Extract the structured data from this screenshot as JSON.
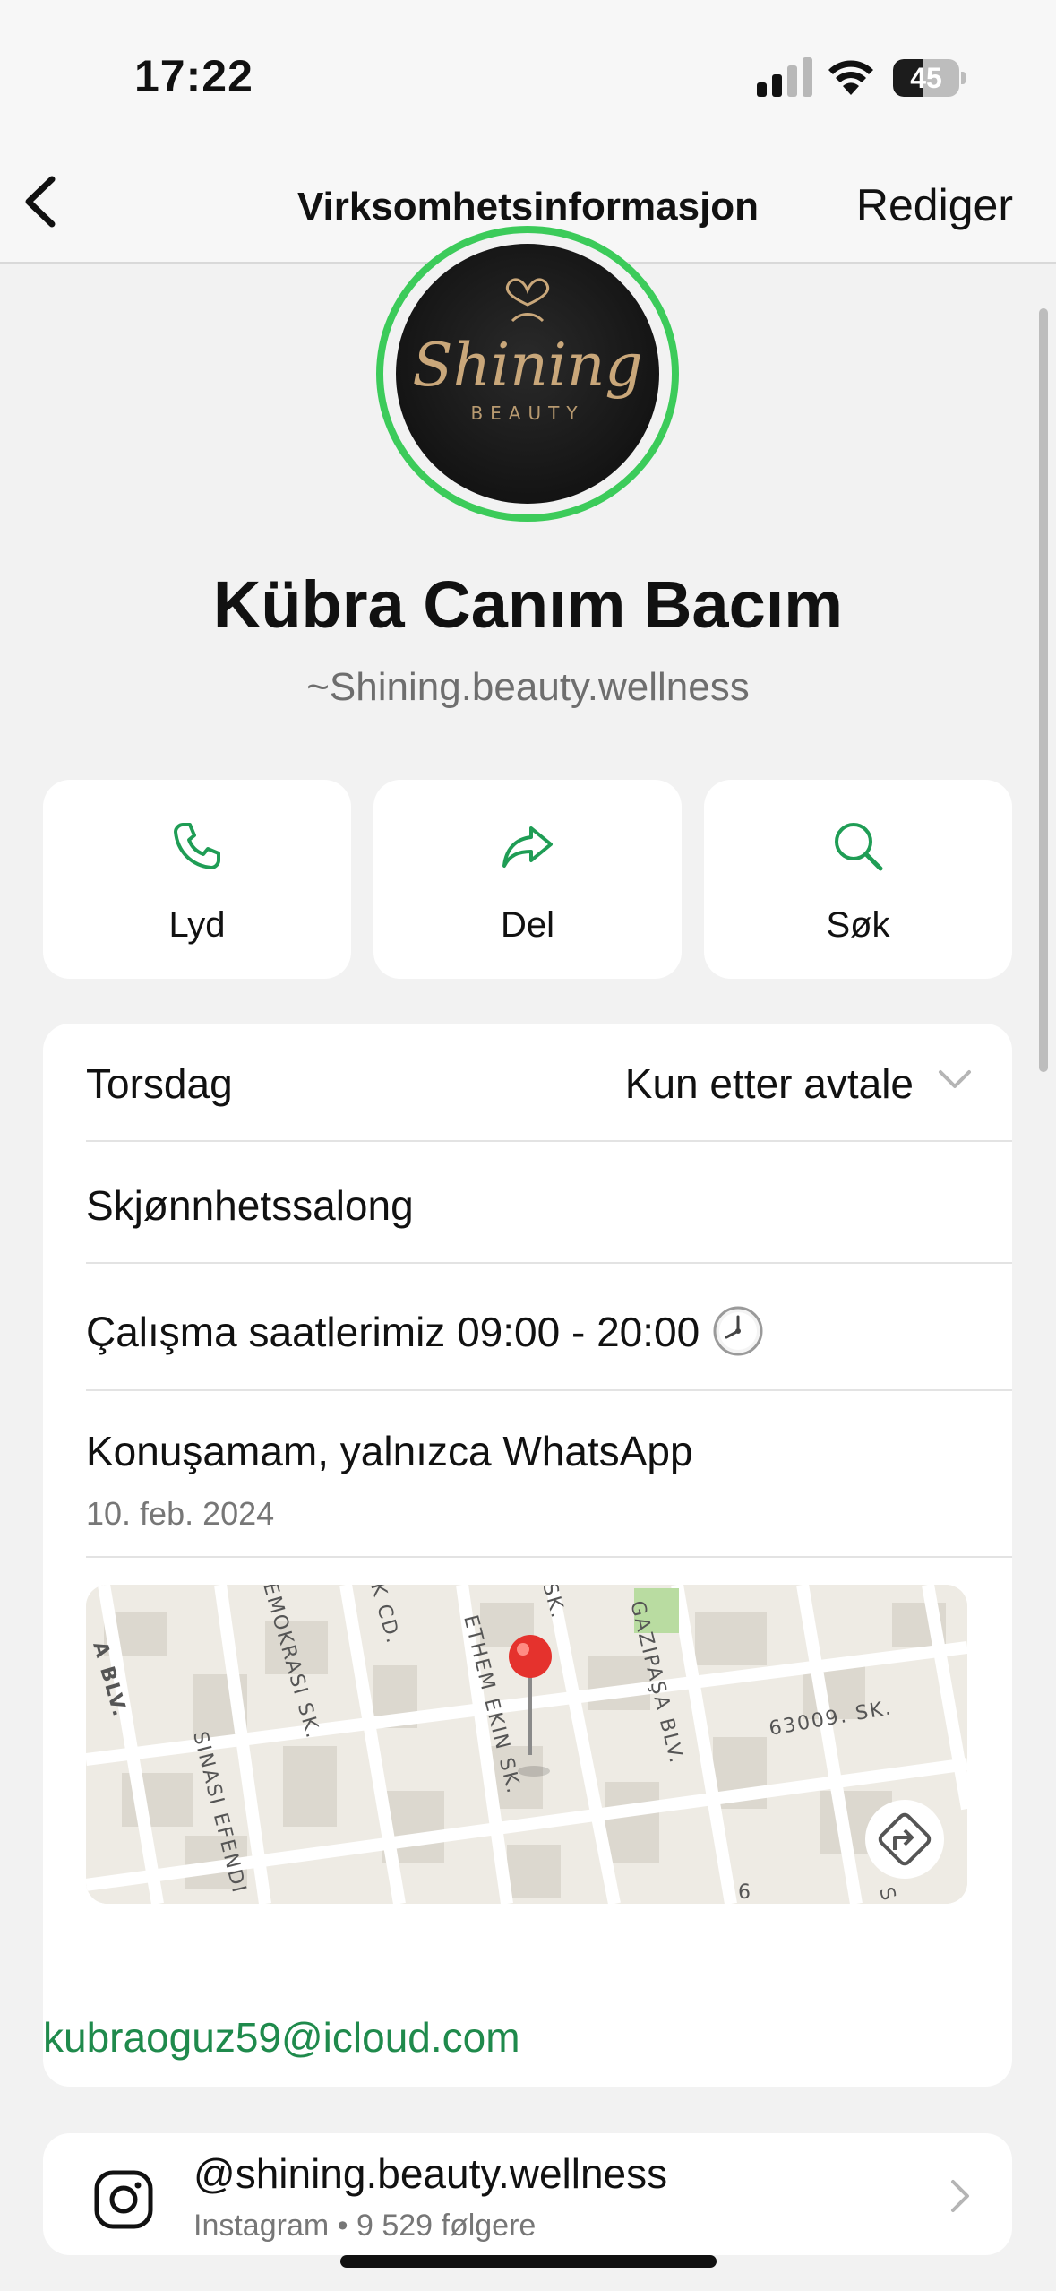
{
  "status_bar": {
    "time": "17:22",
    "battery": "45",
    "battery_level": 0.45
  },
  "nav": {
    "title": "Virksomhetsinformasjon",
    "edit_label": "Rediger"
  },
  "profile": {
    "logo_text": "Shining",
    "logo_subtext": "BEAUTY",
    "name": "Kübra Canım Bacım",
    "handle": "~Shining.beauty.wellness",
    "ring_color": "#3ccb5a"
  },
  "actions": [
    {
      "label": "Lyd",
      "icon": "phone-icon"
    },
    {
      "label": "Del",
      "icon": "share-icon"
    },
    {
      "label": "Søk",
      "icon": "search-icon"
    }
  ],
  "accent_color": "#1f9d55",
  "info": {
    "hours_day": "Torsdag",
    "hours_value": "Kun etter avtale",
    "category": "Skjønnhetssalong",
    "work_hours": "Çalışma saatlerimiz 09:00 - 20:00",
    "about": "Konuşamam, yalnızca WhatsApp",
    "about_date": "10. feb. 2024",
    "email": "kubraoguz59@icloud.com"
  },
  "map": {
    "street_labels": [
      "EMOKRASI SK.",
      "K CD.",
      "SK.",
      "GAZIPAŞA BLV.",
      "A BLV.",
      "SINASI EFENDI",
      "ETHEM EKIN SK.",
      "63009. SK.",
      "6",
      "S"
    ],
    "directions_icon": "directions-icon",
    "pin_icon": "map-pin-icon"
  },
  "instagram": {
    "handle": "@shining.beauty.wellness",
    "meta": "Instagram • 9 529 følgere"
  }
}
